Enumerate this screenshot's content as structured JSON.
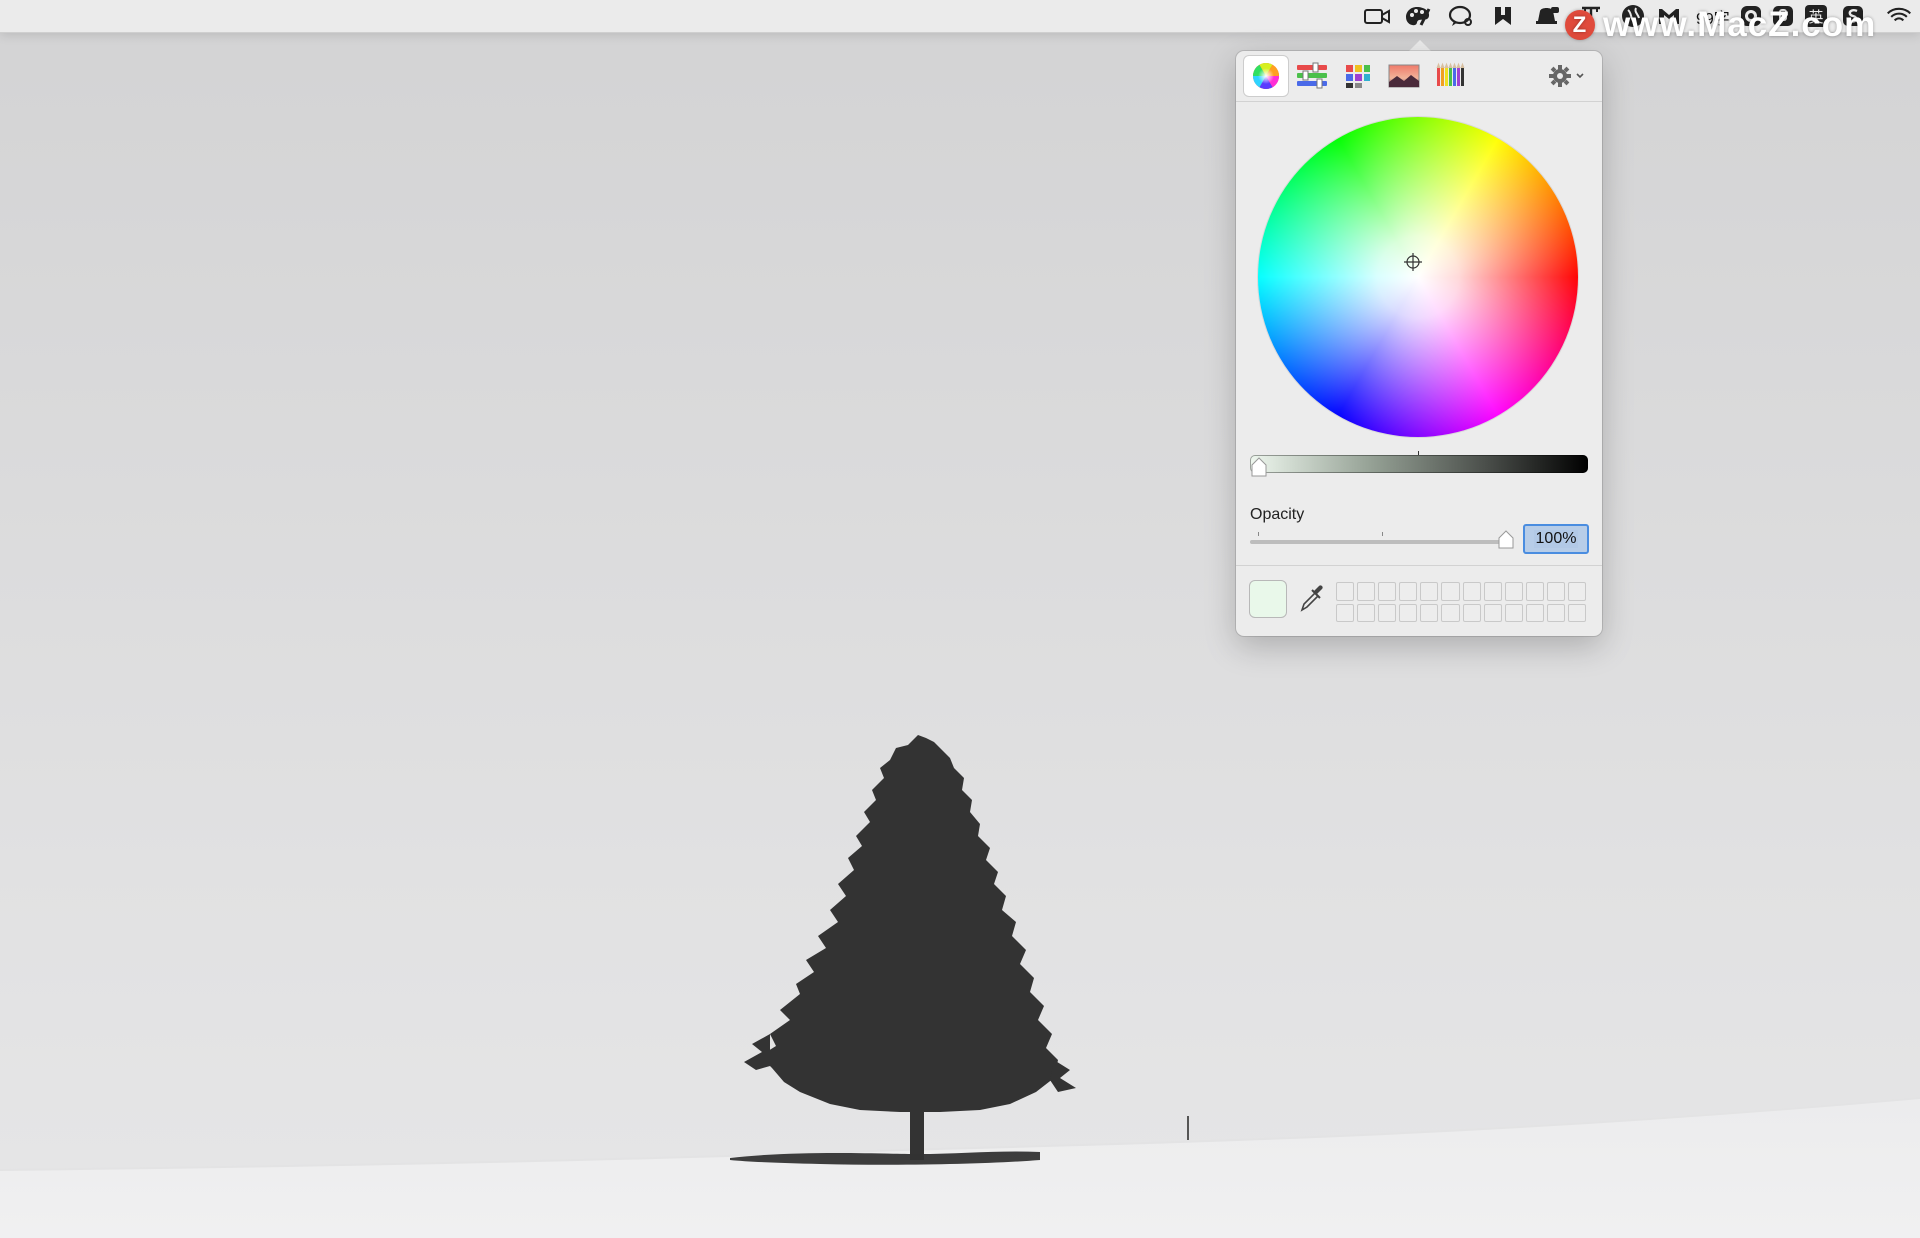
{
  "menubar": {
    "status_items": [
      {
        "name": "facetime-camera-icon"
      },
      {
        "name": "color-palette-icon",
        "active": true
      },
      {
        "name": "chat-bubble-icon"
      },
      {
        "name": "bookmark-app-icon"
      },
      {
        "name": "notification-bell-icon"
      },
      {
        "name": "text-tool-icon"
      },
      {
        "name": "sync-globe-icon"
      },
      {
        "name": "gmail-app-icon"
      },
      {
        "name": "word-counter-icon"
      },
      {
        "name": "keyboard-app-icon"
      },
      {
        "name": "input-method-icon"
      },
      {
        "name": "scrivener-icon"
      },
      {
        "name": "wifi-icon"
      }
    ],
    "word_counter_text": "99字",
    "input_method_text": "英"
  },
  "watermark": {
    "logo_letter": "Z",
    "text": "www.MacZ.com"
  },
  "color_panel": {
    "modes": [
      {
        "name": "color-wheel-mode",
        "active": true
      },
      {
        "name": "color-sliders-mode"
      },
      {
        "name": "color-palettes-mode"
      },
      {
        "name": "image-palettes-mode"
      },
      {
        "name": "pencils-mode"
      }
    ],
    "brightness": 0.0,
    "opacity_label": "Opacity",
    "opacity_value": "100%",
    "opacity_level": 1.0,
    "current_color": "#e9f8ea",
    "swatch_rows": 2,
    "swatch_columns": 12
  },
  "colors": {
    "panel_bg": "#ececec",
    "field_highlight": "#b7cde8",
    "field_border": "#4a8de0",
    "tree": "#333333"
  }
}
